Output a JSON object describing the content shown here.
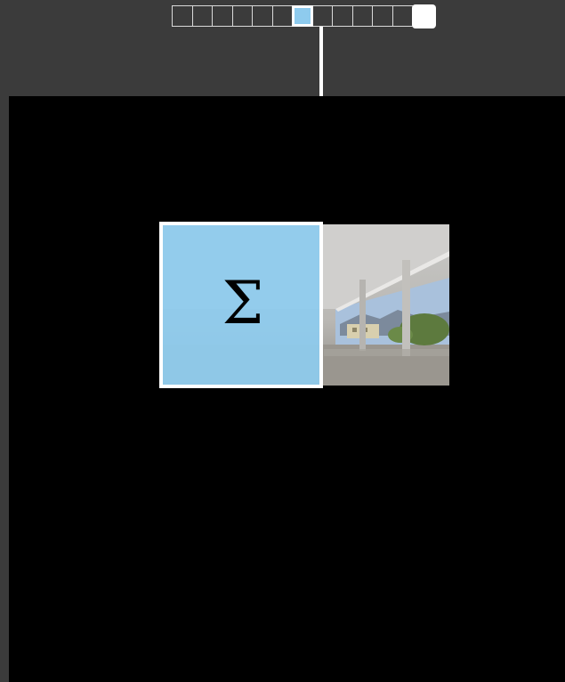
{
  "strip": {
    "cell_count": 13,
    "active_index": 6,
    "end_marker_index": 12
  },
  "colors": {
    "background": "#3b3b3b",
    "canvas": "#000000",
    "highlight": "#8ecbee",
    "outline": "#ffffff"
  },
  "operator": {
    "symbol": "Σ",
    "icon": "summation-icon"
  },
  "image_label": ""
}
